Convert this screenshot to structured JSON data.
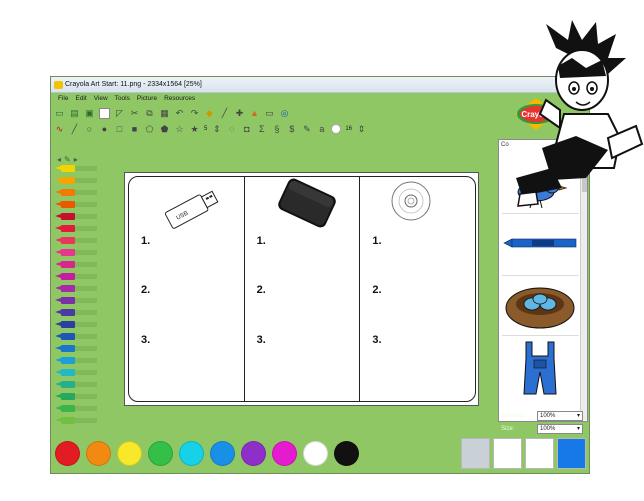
{
  "window": {
    "title": "Crayola Art Start: 11.png - 2334x1564 [25%]",
    "controls": {
      "minimize": "–",
      "maximize": "□",
      "close": "✕"
    }
  },
  "menu": [
    "File",
    "Edit",
    "View",
    "Tools",
    "Picture",
    "Resources"
  ],
  "toolbar": {
    "brush_size": "5",
    "font_size": "16",
    "icons_row1": [
      "open-icon",
      "save-icon",
      "print-icon",
      "select-icon",
      "crop-icon",
      "cut-icon",
      "copy-icon",
      "paste-icon",
      "undo-icon",
      "redo-icon",
      "fill-icon",
      "eyedropper-icon",
      "move-icon",
      "stamp-icon",
      "text-icon",
      "zoom-icon"
    ],
    "icons_row2": [
      "freehand-icon",
      "line-icon",
      "circle-icon",
      "filled-circle-icon",
      "square-icon",
      "filled-square-icon",
      "pentagon-icon",
      "filled-pentagon-icon",
      "star-icon",
      "filled-star-icon"
    ]
  },
  "worksheet": {
    "columns": [
      {
        "item": "USB flash drive",
        "label": "USB",
        "numbers": [
          "1.",
          "2.",
          "3."
        ]
      },
      {
        "item": "external hard drive",
        "numbers": [
          "1.",
          "2.",
          "3."
        ]
      },
      {
        "item": "compact disc",
        "numbers": [
          "1.",
          "2.",
          "3."
        ]
      }
    ]
  },
  "panel": {
    "title": "Co",
    "stamps": [
      "bird-stamp",
      "crayon-stamp",
      "nest-stamp",
      "overalls-stamp"
    ]
  },
  "properties": {
    "spacing_label": "Spacing:",
    "spacing_value": "100%",
    "size_label": "Size:",
    "size_value": "100%"
  },
  "logo_text": "Crayola",
  "crayon_colors": [
    "#f3d400",
    "#f6a400",
    "#ef7b00",
    "#e95a00",
    "#c8102e",
    "#e31c3d",
    "#e8375a",
    "#e5388d",
    "#d7268e",
    "#c31f9d",
    "#a72aa7",
    "#7b2fa8",
    "#4b3aa1",
    "#2b3f9c",
    "#1f56b5",
    "#1b76c8",
    "#1d9fd6",
    "#23b9c4",
    "#26b08a",
    "#27a95b",
    "#3bb54a",
    "#72c043"
  ],
  "palette_colors": [
    "#e31b23",
    "#f28a12",
    "#f7e82a",
    "#34bf49",
    "#16d1e8",
    "#1a8fe6",
    "#8f2fc9",
    "#e51bd0",
    "#ffffff",
    "#111111"
  ],
  "selected_swatch_color": "#1778e8"
}
